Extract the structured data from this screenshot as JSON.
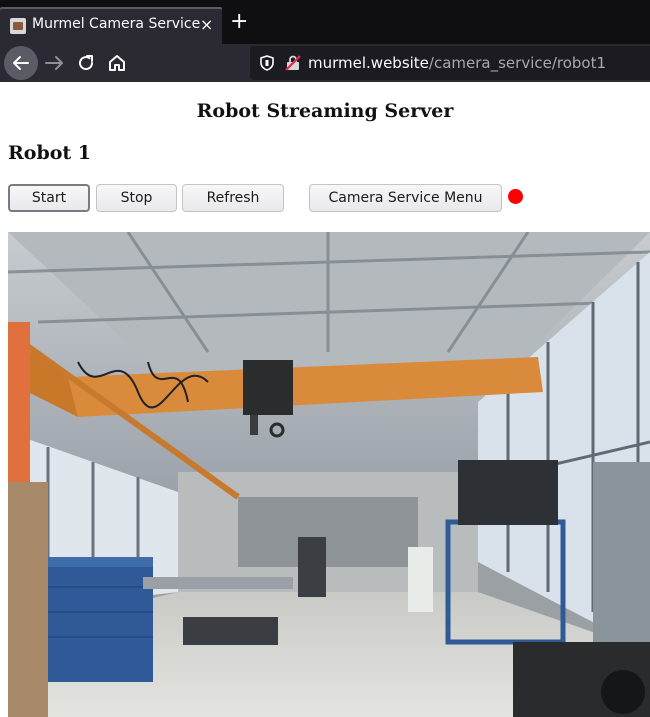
{
  "browser": {
    "tab_title": "Murmel Camera Service",
    "tab_close": "×",
    "new_tab": "+",
    "url_host": "murmel.website",
    "url_path": "/camera_service/robot1"
  },
  "page": {
    "heading": "Robot Streaming Server",
    "robot_title": "Robot 1"
  },
  "controls": {
    "start_label": "Start",
    "stop_label": "Stop",
    "refresh_label": "Refresh",
    "menu_label": "Camera Service Menu"
  },
  "status": {
    "color": "#ff0000"
  },
  "stream": {
    "content": "camera feed: industrial hall with orange overhead crane, blue workbenches, large windows"
  }
}
